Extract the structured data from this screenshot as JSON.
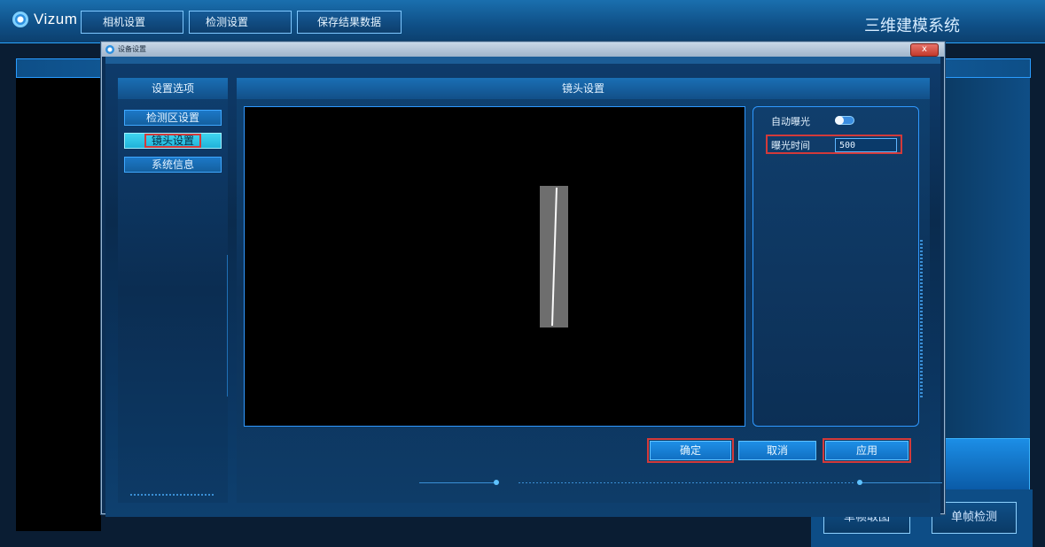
{
  "app": {
    "logo_text": "Vizum",
    "system_title": "三维建模系统"
  },
  "top_tabs": [
    {
      "label": "相机设置"
    },
    {
      "label": "检测设置"
    },
    {
      "label": "保存结果数据"
    }
  ],
  "background_buttons": {
    "single_frame_capture": "单帧取图",
    "single_frame_detect": "单帧检测"
  },
  "dialog": {
    "title": "设备设置",
    "close": "x",
    "options_header": "设置选项",
    "options": [
      {
        "label": "检测区设置",
        "active": false
      },
      {
        "label": "镜头设置",
        "active": true
      },
      {
        "label": "系统信息",
        "active": false
      }
    ],
    "main_header": "镜头设置",
    "params": {
      "auto_exposure_label": "自动曝光",
      "auto_exposure_on": true,
      "exposure_time_label": "曝光时间",
      "exposure_time_value": "500"
    },
    "buttons": {
      "confirm": "确定",
      "cancel": "取消",
      "apply": "应用"
    }
  },
  "colors": {
    "accent": "#2f98ff",
    "highlight_outline": "#d33a3a",
    "active_option": "#3fd5f0"
  }
}
